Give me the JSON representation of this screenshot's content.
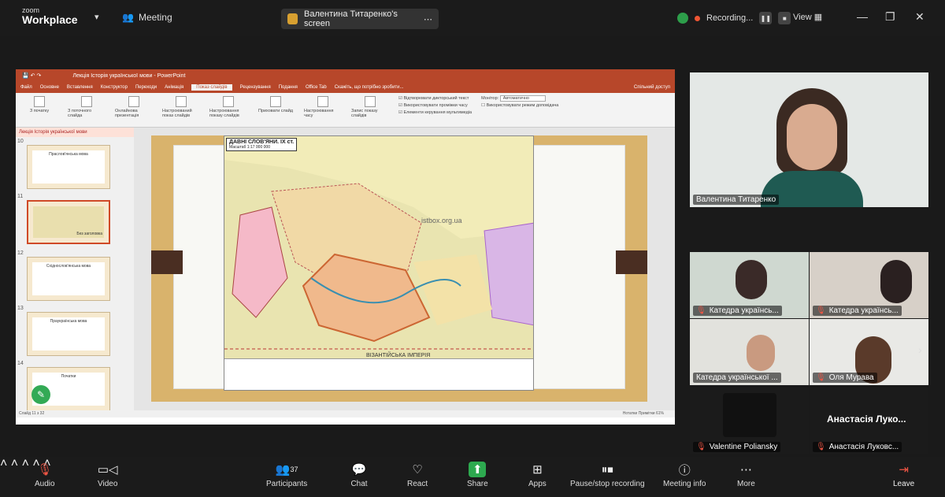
{
  "titlebar": {
    "logo_small": "zoom",
    "logo_big": "Workplace",
    "meeting_label": "Meeting",
    "screen_label": "Валентина Титаренко's screen",
    "recording_label": "Recording...",
    "view_label": "View"
  },
  "ppt": {
    "title": "Лекція Історія української мови - PowerPoint",
    "tabs": [
      "Файл",
      "Основне",
      "Вставлення",
      "Конструктор",
      "Переходи",
      "Анімація",
      "Показ слайдів",
      "Рецензування",
      "Подання",
      "Office Tab",
      "Скажіть, що потрібно зробити..."
    ],
    "active_tab": "Показ слайдів",
    "share_label": "Спільний доступ",
    "ribbon_groups": [
      "З початку",
      "З поточного слайда",
      "Онлайнова презентація",
      "Настроюваний показ слайдів",
      "Настроювання показу слайдів",
      "Приховати слайд",
      "Настроювання часу",
      "Запис показу слайдів"
    ],
    "checks": [
      "Відтворювати дикторський текст",
      "Використовувати проміжки часу",
      "Елементи керування мультимедіа"
    ],
    "monitor_label": "Монітор:",
    "monitor_value": "Автоматично",
    "presenter_label": "Використовувати режим доповідача",
    "doc_tab": "Лекція Історія української мови",
    "slide_numbers": [
      "10",
      "11",
      "12",
      "13",
      "14"
    ],
    "thumb_titles": [
      "Праслов'янська мова",
      "Без заголовка",
      "Східнослов'янська мова",
      "Праукраїнська мова",
      "Початки"
    ],
    "map_title": "ДАВНІ СЛОВ'ЯНИ. IX ст.",
    "map_subtitle": "Масштаб 1:17 000 000",
    "map_watermark": "istbox.org.ua",
    "map_bottom_label": "ВІЗАНТІЙСЬКА ІМПЕРІЯ",
    "status_left": "Слайд 11 з 32",
    "status_right": "Нотатки   Примітки   61%"
  },
  "participants": {
    "main_name": "Валентина Титаренко",
    "tiles": [
      {
        "name": "Катедра українсь..."
      },
      {
        "name": "Катедра українсь..."
      },
      {
        "name": "Катедра української ..."
      },
      {
        "name": "Оля Мурава"
      },
      {
        "name": "Valentine Poliansky"
      },
      {
        "name": "Анастасія Луковс..."
      }
    ],
    "big_name": "Анастасія Луко..."
  },
  "toolbar": {
    "audio": "Audio",
    "video": "Video",
    "participants": "Participants",
    "participants_count": "37",
    "chat": "Chat",
    "react": "React",
    "share": "Share",
    "apps": "Apps",
    "pause_recording": "Pause/stop recording",
    "meeting_info": "Meeting info",
    "more": "More",
    "leave": "Leave"
  },
  "colors": {
    "ppt_accent": "#b7472a",
    "share_green": "#2da94f",
    "bg": "#1a1a1a"
  }
}
